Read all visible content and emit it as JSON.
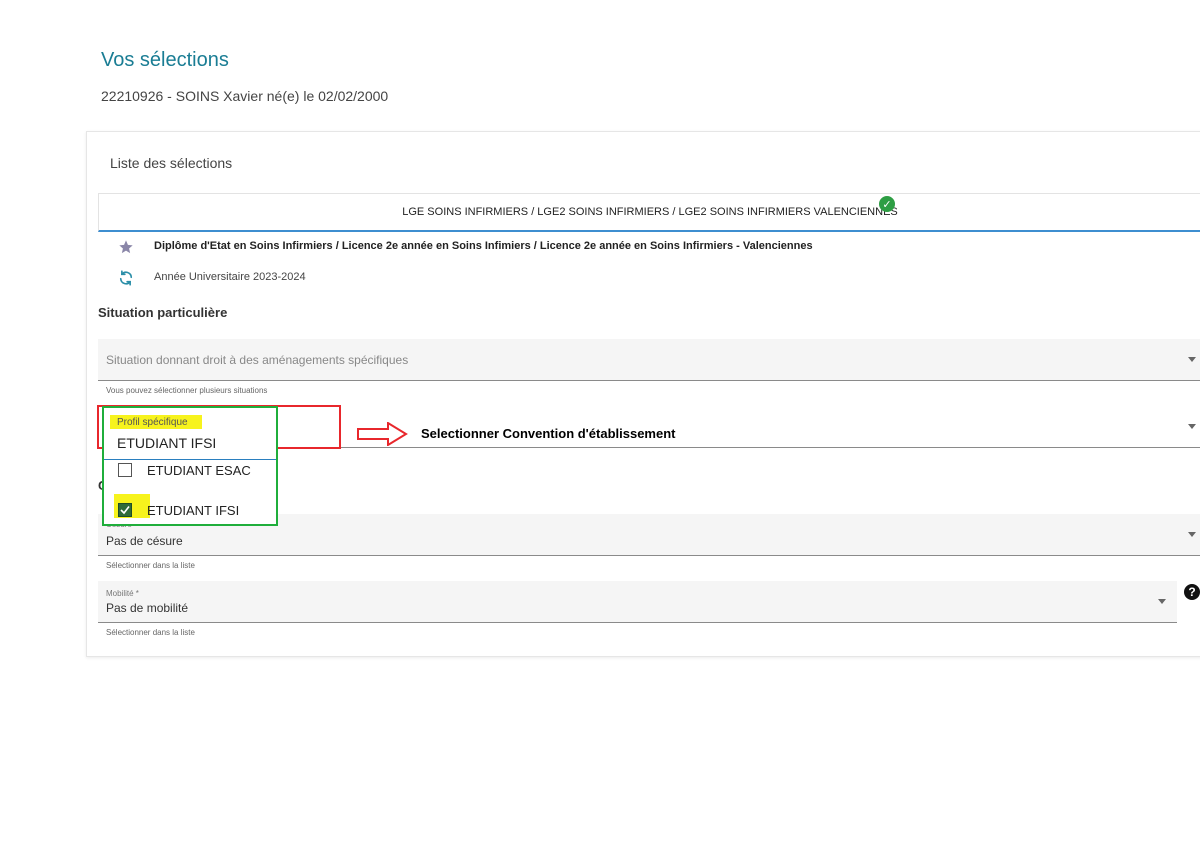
{
  "header": {
    "title": "Vos sélections",
    "student_info": "22210926 - SOINS Xavier né(e) le 02/02/2000"
  },
  "card": {
    "title": "Liste des sélections",
    "tab_label": "LGE SOINS INFIRMIERS / LGE2 SOINS INFIRMIERS / LGE2 SOINS INFIRMIERS VALENCIENNES",
    "tab_check": "✓",
    "diploma": "Diplôme d'Etat en Soins Infirmiers / Licence 2e année en Soins Infimiers / Licence 2e année en Soins Infirmiers - Valenciennes",
    "year": "Année Universitaire 2023-2024"
  },
  "situation": {
    "title": "Situation particulière",
    "placeholder": "Situation donnant droit à des aménagements spécifiques",
    "hint": "Vous pouvez sélectionner plusieurs situations"
  },
  "profil": {
    "label": "Profil spécifique",
    "value": "ETUDIANT IFSI",
    "options": [
      {
        "label": "ETUDIANT ESAC",
        "checked": false
      },
      {
        "label": "ETUDIANT IFSI",
        "checked": true
      }
    ]
  },
  "annotation": {
    "text": "Selectionner Convention d'établissement"
  },
  "hidden_heading_fragment": "C",
  "cesure": {
    "label": "Césure",
    "value": "Pas de césure",
    "hint": "Sélectionner dans la liste"
  },
  "mobilite": {
    "label": "Mobilité *",
    "value": "Pas de mobilité",
    "hint": "Sélectionner dans la liste",
    "help": "?"
  },
  "colors": {
    "title": "#1a7d94",
    "accent": "#3e8ed0",
    "check": "#2e9e44",
    "red_annotation": "#e8272c",
    "green_annotation": "#1fae3b",
    "highlight": "#f7f31d"
  }
}
